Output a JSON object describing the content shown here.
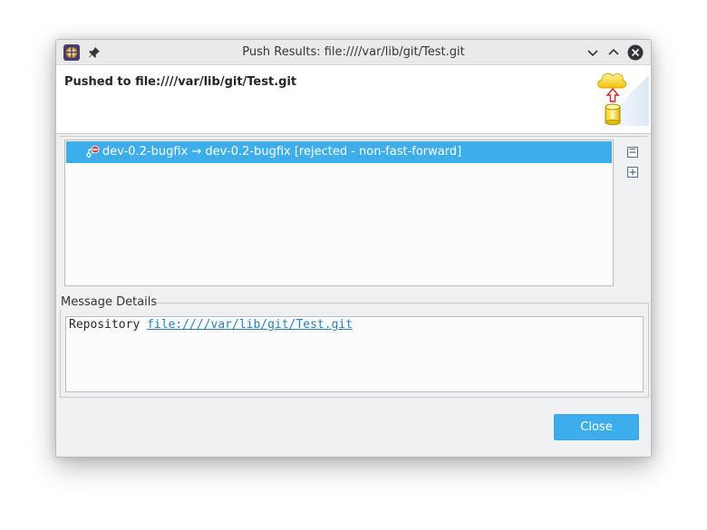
{
  "window": {
    "title": "Push Results: file:////var/lib/git/Test.git"
  },
  "icons": {
    "app": "eclipse-app-icon",
    "pin": "pin-icon",
    "minimize": "chevron-down-icon",
    "maximize": "chevron-up-icon",
    "close": "close-icon",
    "wizard": "cloud-push-icon",
    "ref": "rejected-ref-icon",
    "collapse": "collapse-all-icon",
    "expand": "expand-all-icon"
  },
  "header": {
    "title": "Pushed to file:////var/lib/git/Test.git"
  },
  "results": {
    "rows": [
      {
        "text": "dev-0.2-bugfix → dev-0.2-bugfix [rejected - non-fast-forward]",
        "selected": true
      }
    ]
  },
  "message_details": {
    "label": "Message Details",
    "prefix": "Repository ",
    "link": "file:////var/lib/git/Test.git"
  },
  "buttons": {
    "close": "Close"
  },
  "colors": {
    "selection": "#3daee9",
    "accent_button": "#3daee9",
    "link": "#2980b9",
    "rejected": "#d94040"
  }
}
